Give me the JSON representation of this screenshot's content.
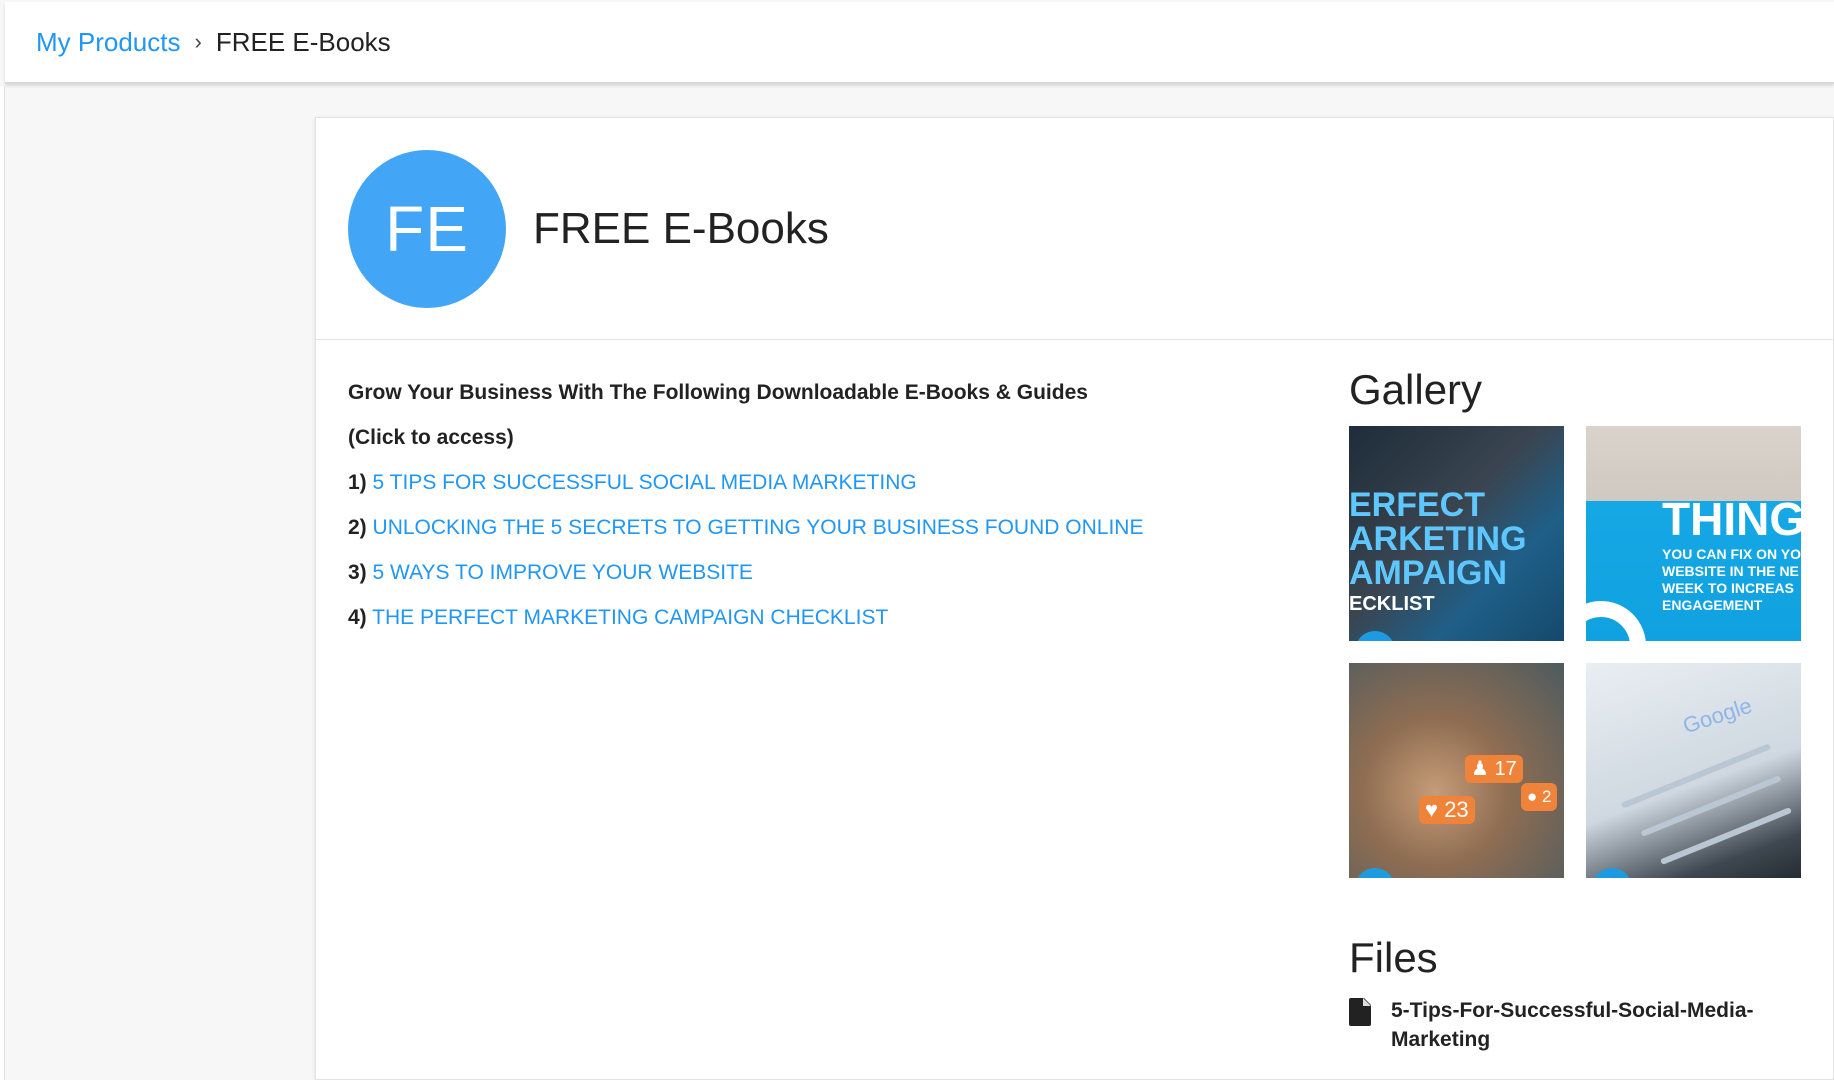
{
  "breadcrumb": {
    "link": "My Products",
    "separator": "›",
    "current": "FREE E-Books"
  },
  "product": {
    "avatar_initials": "FE",
    "title": "FREE E-Books",
    "avatar_color": "#42a5f5"
  },
  "content": {
    "heading": "Grow Your Business With The Following Downloadable E-Books & Guides",
    "instruction": "(Click to access)",
    "items": [
      {
        "number": "1)",
        "label": "5 TIPS FOR SUCCESSFUL SOCIAL MEDIA MARKETING"
      },
      {
        "number": "2)",
        "label": "UNLOCKING THE 5 SECRETS TO GETTING YOUR BUSINESS FOUND ONLINE"
      },
      {
        "number": "3)",
        "label": "5 WAYS TO IMPROVE YOUR WEBSITE"
      },
      {
        "number": "4)",
        "label": "THE PERFECT MARKETING CAMPAIGN CHECKLIST"
      }
    ]
  },
  "gallery": {
    "title": "Gallery",
    "images": [
      {
        "lines": [
          "ERFECT",
          "ARKETING",
          "AMPAIGN",
          "ECKLIST"
        ]
      },
      {
        "lines": [
          "THING",
          "YOU CAN FIX ON YO WEBSITE IN THE NE WEEK TO INCREAS ENGAGEMENT"
        ]
      },
      {
        "lines": [
          "17",
          "23",
          "2"
        ]
      },
      {
        "lines": [
          "Google"
        ]
      }
    ]
  },
  "files": {
    "title": "Files",
    "items": [
      {
        "name": "5-Tips-For-Successful-Social-Media-Marketing"
      }
    ]
  },
  "colors": {
    "link": "#2196f3",
    "accent": "#42a5f5"
  }
}
